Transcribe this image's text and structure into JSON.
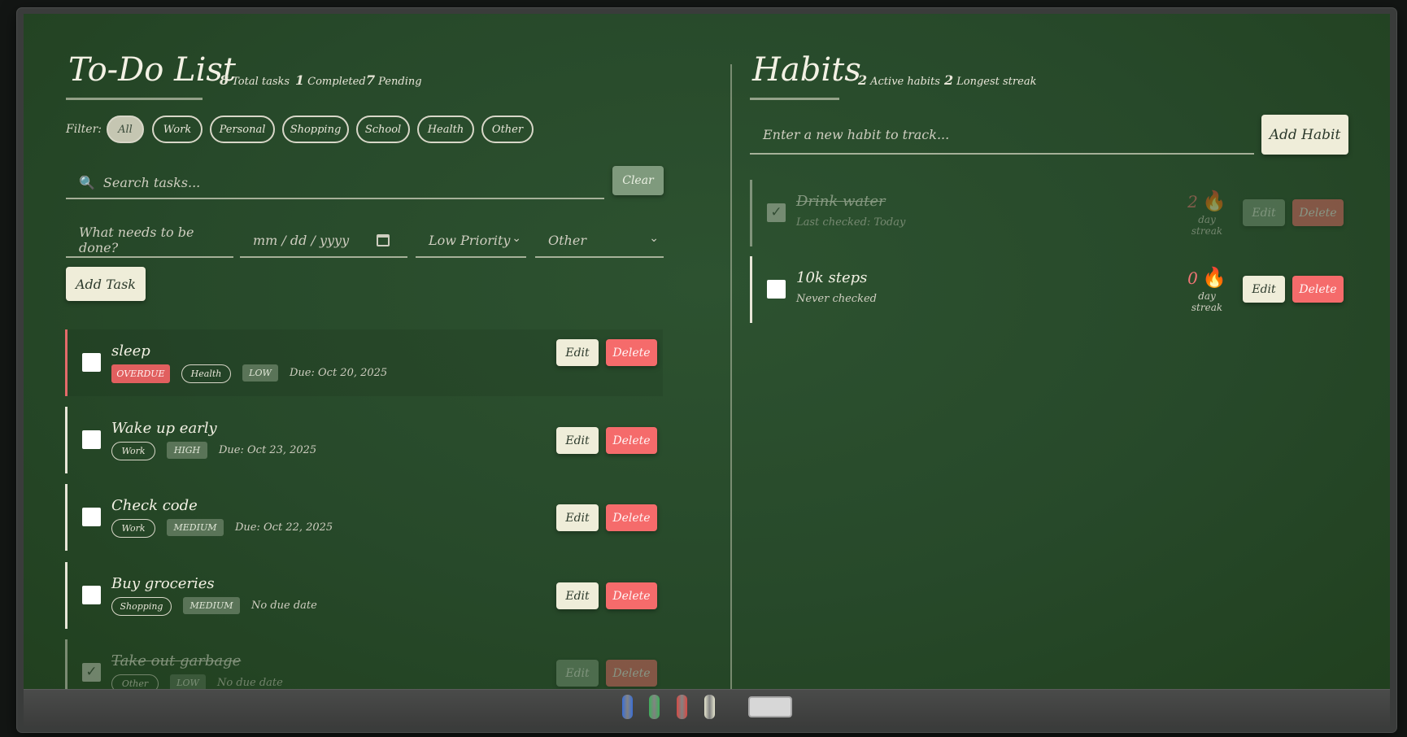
{
  "todo": {
    "title": "To-Do List",
    "stats": [
      {
        "value": "8",
        "label": "Total tasks"
      },
      {
        "value": "1",
        "label": "Completed"
      },
      {
        "value": "7",
        "label": "Pending"
      }
    ],
    "filter_label": "Filter:",
    "filters": [
      "All",
      "Work",
      "Personal",
      "Shopping",
      "School",
      "Health",
      "Other"
    ],
    "active_filter": "All",
    "search_placeholder": "Search tasks...",
    "search_icon": "magnifier-icon",
    "clear_label": "Clear",
    "new_task_placeholder": "What needs to be done?",
    "date_placeholder": "mm / dd / yyyy",
    "priority_value": "Low Priority",
    "category_value": "Other",
    "add_task_label": "Add Task",
    "edit_label": "Edit",
    "delete_label": "Delete",
    "tasks": [
      {
        "title": "sleep",
        "badge": "OVERDUE",
        "category": "Health",
        "priority": "LOW",
        "due": "Due: Oct 20, 2025",
        "completed": false
      },
      {
        "title": "Wake up early",
        "category": "Work",
        "priority": "HIGH",
        "due": "Due: Oct 23, 2025",
        "completed": false
      },
      {
        "title": "Check code",
        "category": "Work",
        "priority": "MEDIUM",
        "due": "Due: Oct 22, 2025",
        "completed": false
      },
      {
        "title": "Buy groceries",
        "category": "Shopping",
        "priority": "MEDIUM",
        "due": "No due date",
        "completed": false
      },
      {
        "title": "Take out garbage",
        "category": "Other",
        "priority": "LOW",
        "due": "No due date",
        "completed": true
      }
    ]
  },
  "habits": {
    "title": "Habits",
    "stats": [
      {
        "value": "2",
        "label": "Active habits"
      },
      {
        "value": "2",
        "label": "Longest streak"
      }
    ],
    "input_placeholder": "Enter a new habit to track...",
    "add_label": "Add Habit",
    "streak_label": "day streak",
    "edit_label": "Edit",
    "delete_label": "Delete",
    "items": [
      {
        "name": "Drink water",
        "sub": "Last checked: Today",
        "streak": "2",
        "completed": true
      },
      {
        "name": "10k steps",
        "sub": "Never checked",
        "streak": "0",
        "completed": false
      }
    ]
  },
  "tray": {
    "chalk_colors": [
      "#3a6fd8",
      "#3fae5a",
      "#d84a45",
      "#e6e6cf"
    ]
  }
}
